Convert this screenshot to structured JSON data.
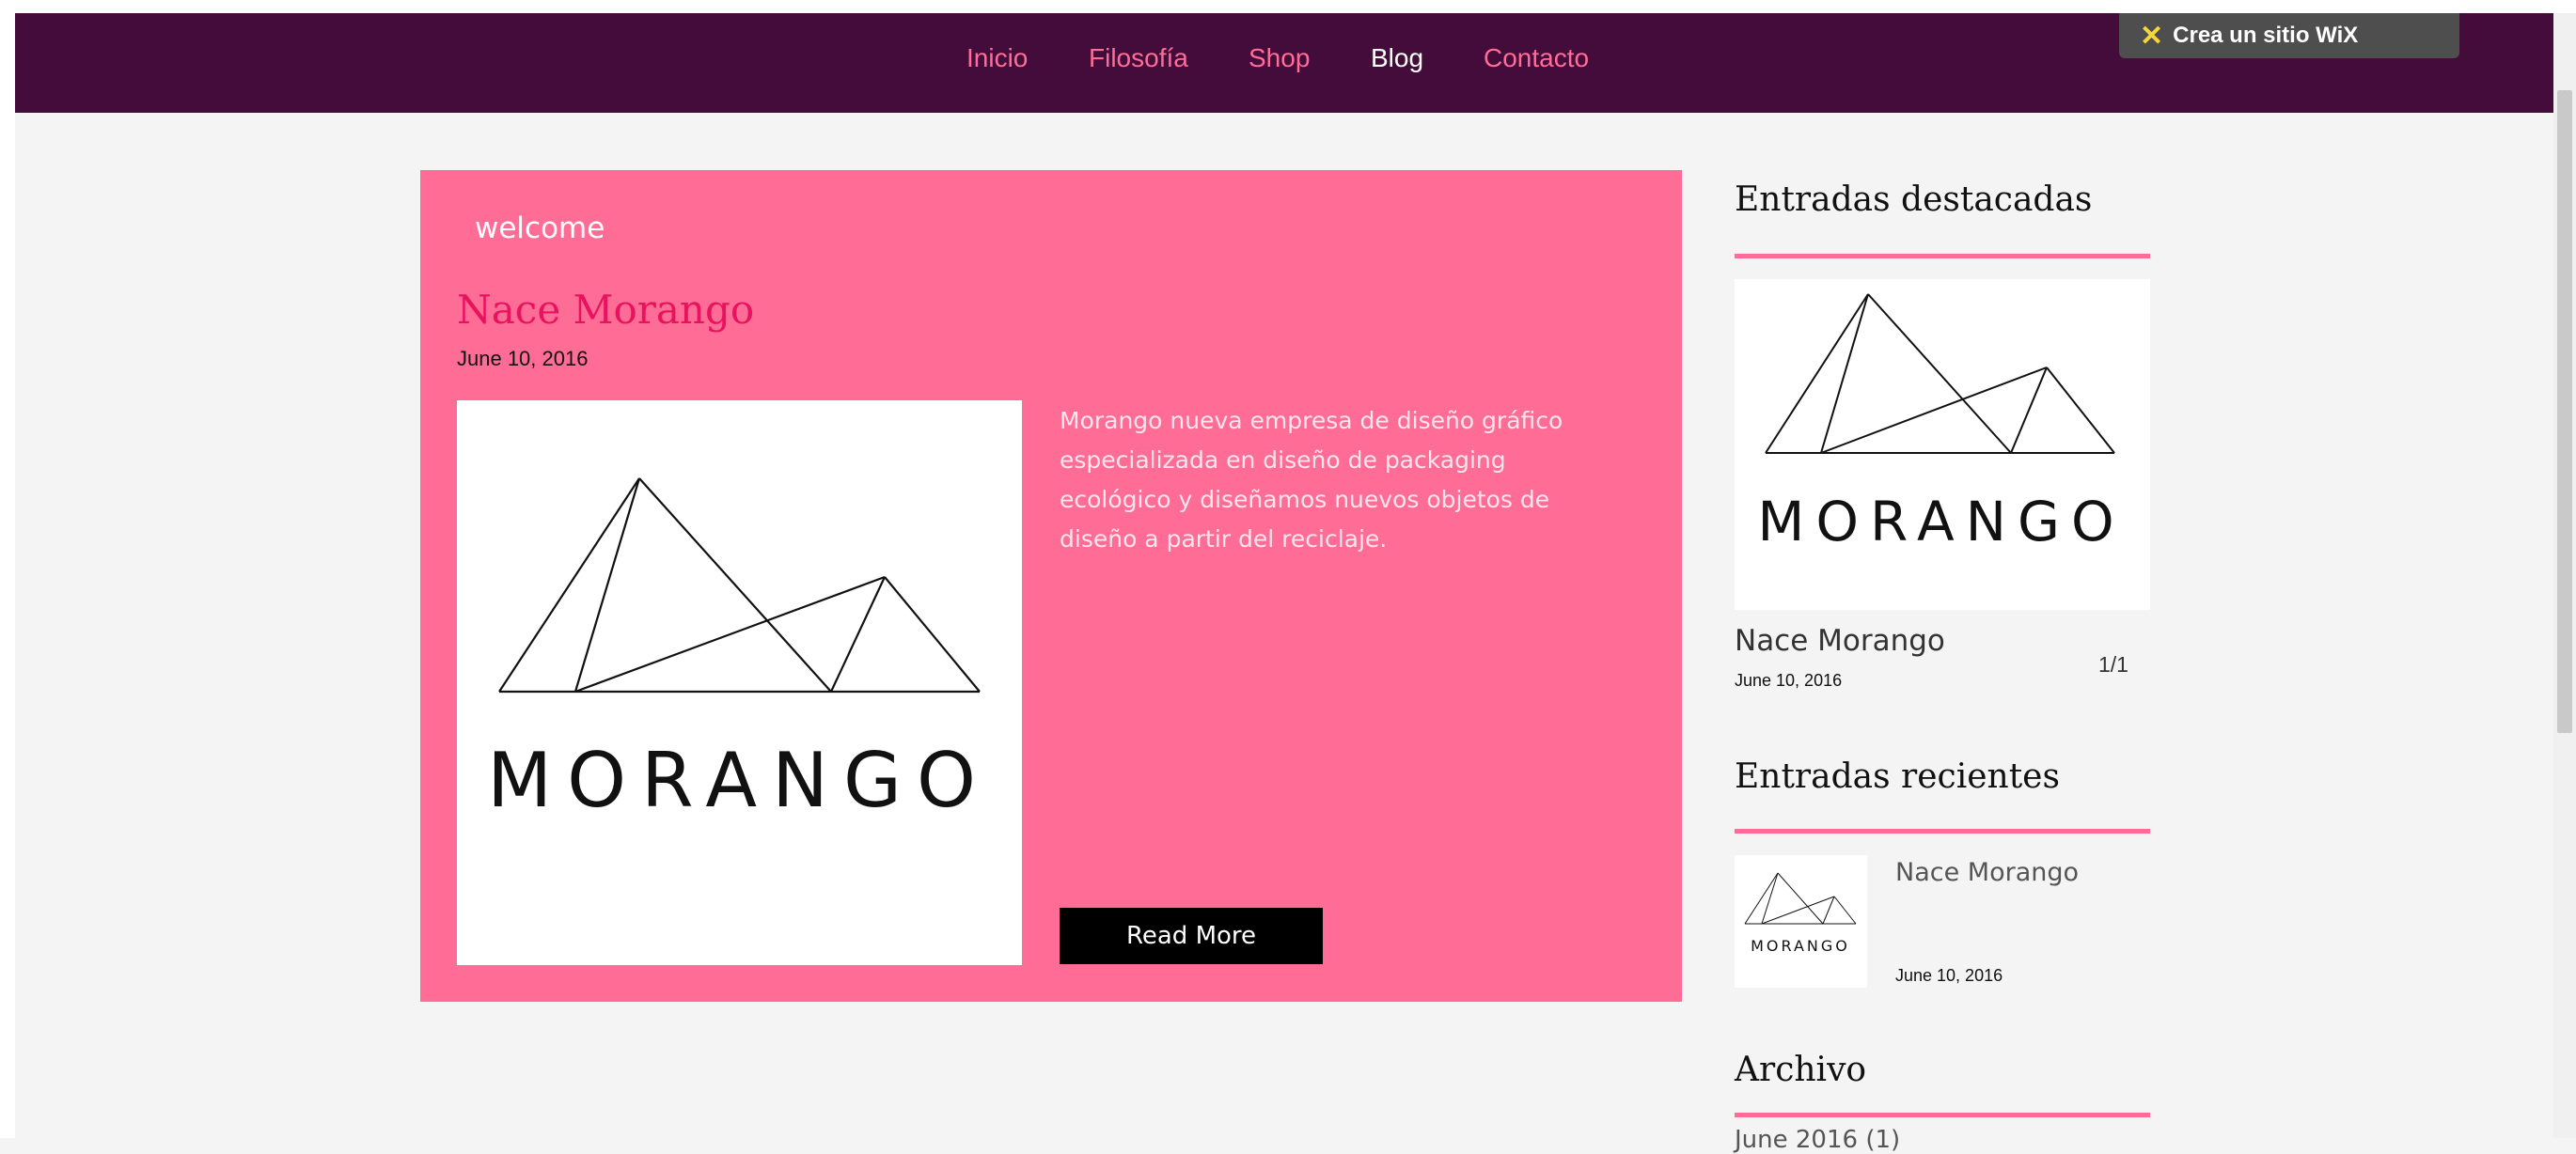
{
  "nav": {
    "items": [
      "Inicio",
      "Filosofía",
      "Shop",
      "Blog",
      "Contacto"
    ],
    "active": "Blog"
  },
  "wix_banner": {
    "label": "Crea un sitio WiX"
  },
  "post": {
    "category": "welcome",
    "title": "Nace Morango",
    "date": "June 10, 2016",
    "logo_text": "MORANGO",
    "excerpt": "Morango nueva empresa de diseño gráfico especializada en diseño de packaging ecológico y diseñamos nuevos objetos de diseño a partir del reciclaje.",
    "read_more": "Read More"
  },
  "sidebar": {
    "featured": {
      "heading": "Entradas destacadas",
      "logo_text": "MORANGO",
      "title": "Nace Morango",
      "date": "June 10, 2016",
      "count": "1/1"
    },
    "recent": {
      "heading": "Entradas recientes",
      "logo_text": "MORANGO",
      "title": "Nace Morango",
      "date": "June 10, 2016"
    },
    "archive": {
      "heading": "Archivo",
      "item": "June 2016 (1)"
    }
  },
  "colors": {
    "navbar": "#430c3b",
    "accent_pink": "#ff6c96",
    "title_pink": "#e8125f",
    "background": "#f4f4f4"
  }
}
